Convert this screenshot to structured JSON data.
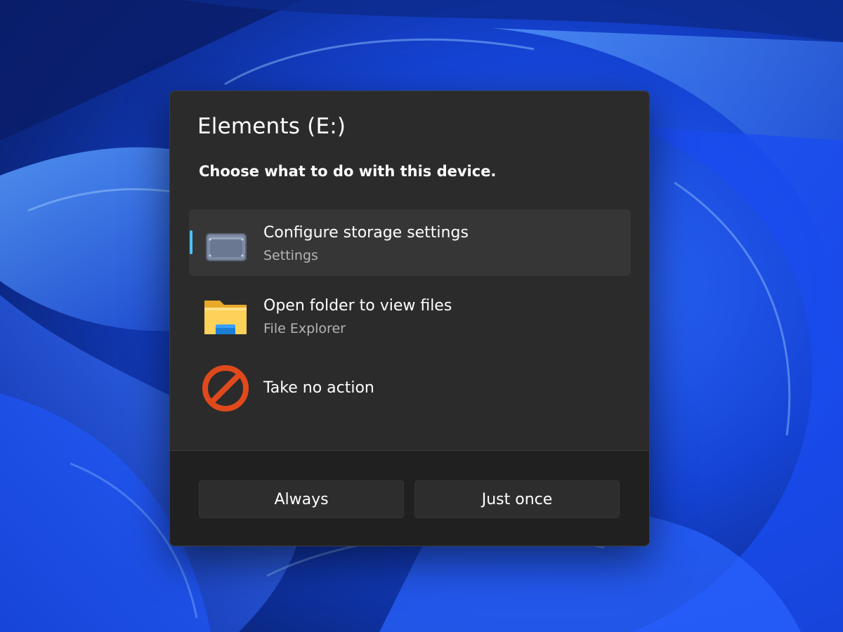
{
  "dialog": {
    "title": "Elements (E:)",
    "prompt": "Choose what to do with this device."
  },
  "options": [
    {
      "title": "Configure storage settings",
      "subtitle": "Settings",
      "icon": "storage-drive-icon",
      "selected": true
    },
    {
      "title": "Open folder to view files",
      "subtitle": "File Explorer",
      "icon": "folder-icon",
      "selected": false
    },
    {
      "title": "Take no action",
      "icon": "no-action-icon",
      "selected": false
    }
  ],
  "buttons": {
    "always": "Always",
    "just_once": "Just once"
  },
  "colors": {
    "accent": "#4cc2ff",
    "dialog_bg": "#2b2b2b",
    "footer_bg": "#202020",
    "no_action_red": "#e0491c",
    "folder_yellow": "#f7c948"
  }
}
